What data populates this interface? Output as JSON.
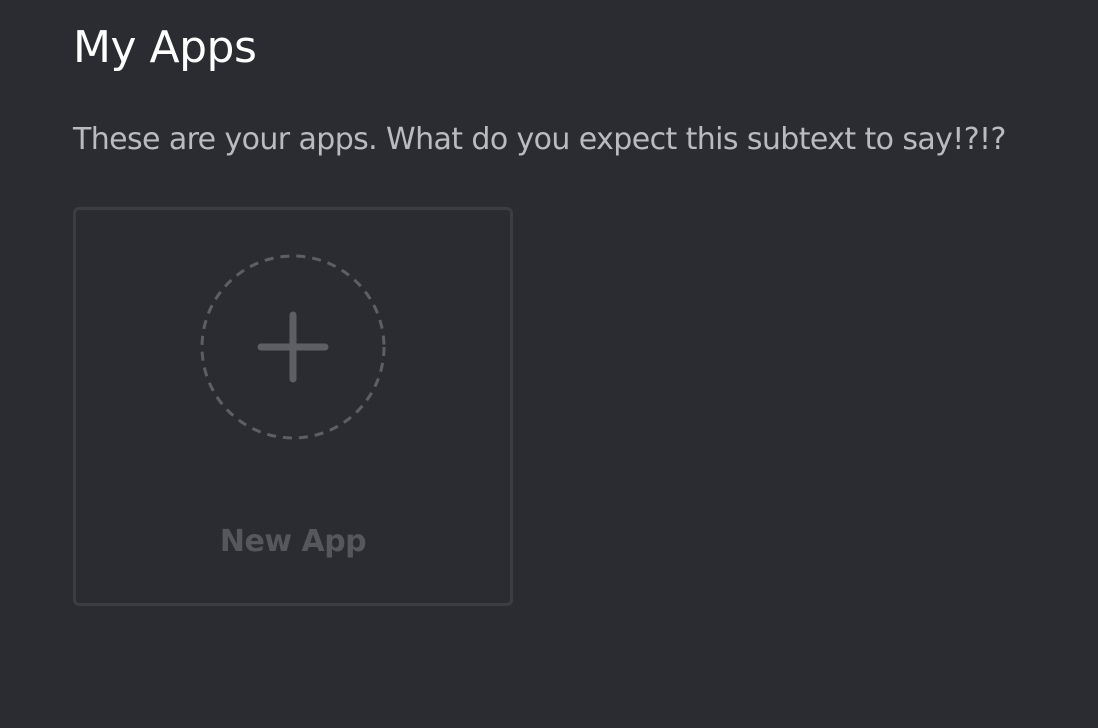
{
  "header": {
    "title": "My Apps",
    "subtitle": "These are your apps. What do you expect this subtext to say!?!?"
  },
  "new_app_card": {
    "label": "New App",
    "icon": "plus-icon"
  },
  "colors": {
    "background": "#2a2c31",
    "card_border": "#3b3d43",
    "icon": "#5d5f64",
    "label": "#55575c",
    "title": "#ffffff",
    "subtitle": "#b9bbbe"
  }
}
